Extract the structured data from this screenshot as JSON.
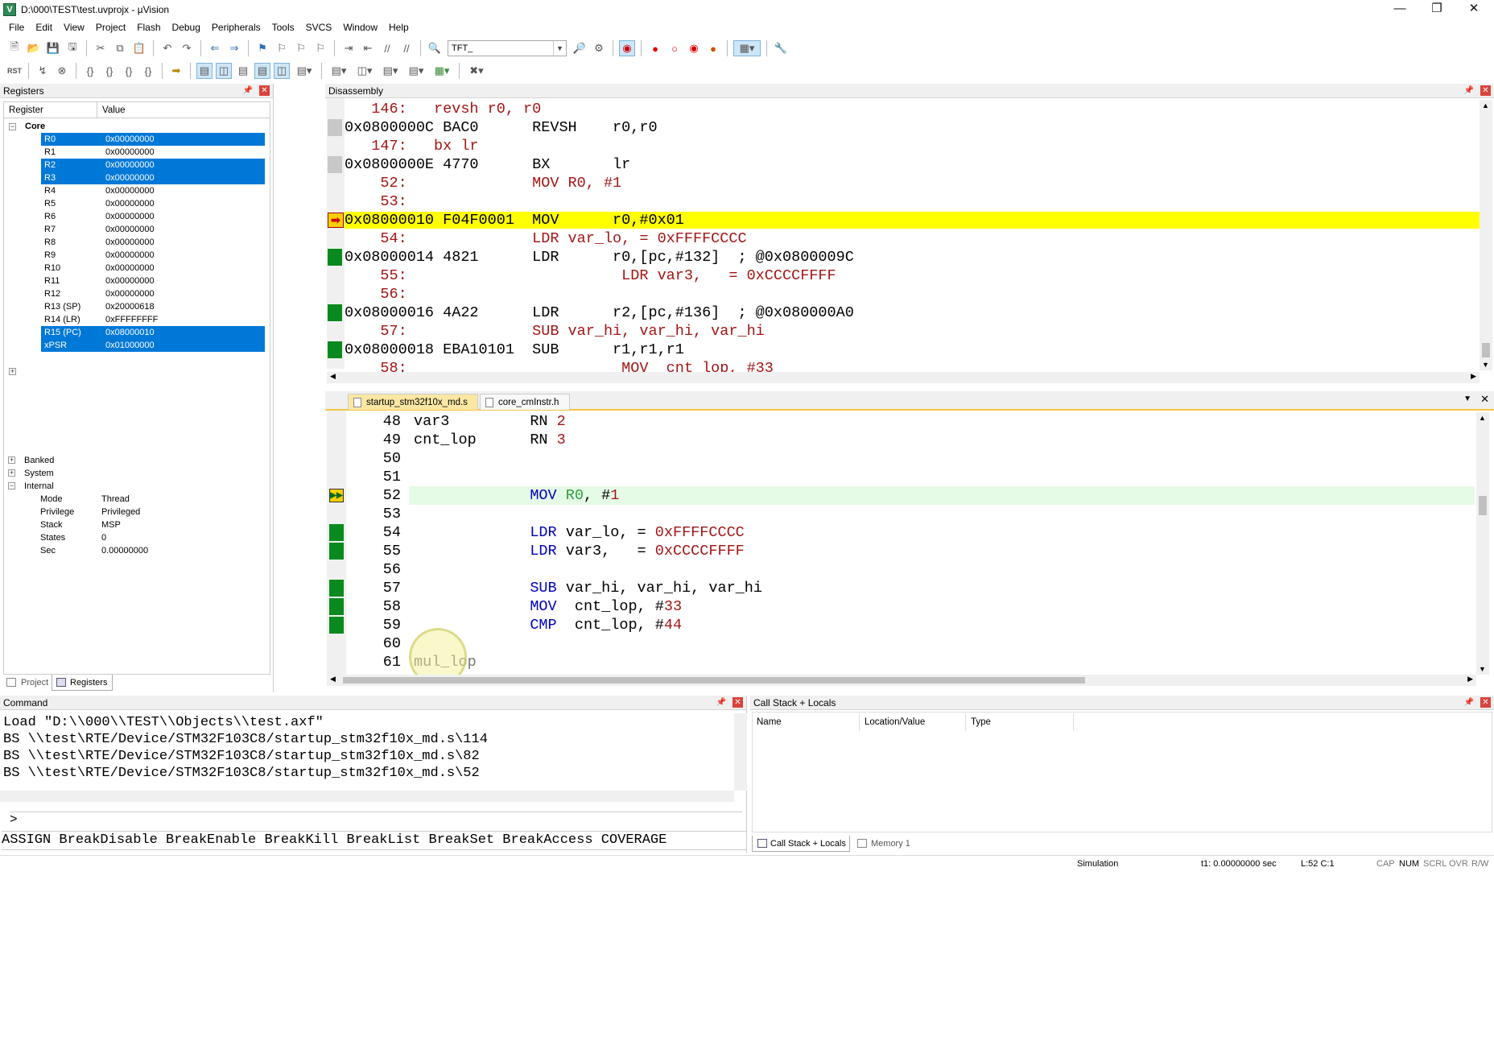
{
  "window": {
    "title": "D:\\000\\TEST\\test.uvprojx - µVision",
    "icon": "uvision-icon",
    "controls": [
      "minimize",
      "restore",
      "close"
    ]
  },
  "menu": [
    "File",
    "Edit",
    "View",
    "Project",
    "Flash",
    "Debug",
    "Peripherals",
    "Tools",
    "SVCS",
    "Window",
    "Help"
  ],
  "toolbar": {
    "target_combo": "TFT_"
  },
  "registers": {
    "title": "Registers",
    "col_register": "Register",
    "col_value": "Value",
    "core_label": "Core",
    "rows": [
      {
        "name": "R0",
        "value": "0x00000000",
        "selected": true
      },
      {
        "name": "R1",
        "value": "0x00000000",
        "selected": false
      },
      {
        "name": "R2",
        "value": "0x00000000",
        "selected": true
      },
      {
        "name": "R3",
        "value": "0x00000000",
        "selected": true
      },
      {
        "name": "R4",
        "value": "0x00000000",
        "selected": false
      },
      {
        "name": "R5",
        "value": "0x00000000",
        "selected": false
      },
      {
        "name": "R6",
        "value": "0x00000000",
        "selected": false
      },
      {
        "name": "R7",
        "value": "0x00000000",
        "selected": false
      },
      {
        "name": "R8",
        "value": "0x00000000",
        "selected": false
      },
      {
        "name": "R9",
        "value": "0x00000000",
        "selected": false
      },
      {
        "name": "R10",
        "value": "0x00000000",
        "selected": false
      },
      {
        "name": "R11",
        "value": "0x00000000",
        "selected": false
      },
      {
        "name": "R12",
        "value": "0x00000000",
        "selected": false
      },
      {
        "name": "R13 (SP)",
        "value": "0x20000618",
        "selected": false
      },
      {
        "name": "R14 (LR)",
        "value": "0xFFFFFFFF",
        "selected": false
      },
      {
        "name": "R15 (PC)",
        "value": "0x08000010",
        "selected": true
      },
      {
        "name": "xPSR",
        "value": "0x01000000",
        "selected": true
      }
    ],
    "groups": {
      "banked": "Banked",
      "system": "System",
      "internal": "Internal"
    },
    "internal": [
      {
        "name": "Mode",
        "value": "Thread"
      },
      {
        "name": "Privilege",
        "value": "Privileged"
      },
      {
        "name": "Stack",
        "value": "MSP"
      },
      {
        "name": "States",
        "value": "0"
      },
      {
        "name": "Sec",
        "value": "0.00000000"
      }
    ],
    "tabs": {
      "project": "Project",
      "registers": "Registers"
    }
  },
  "disassembly": {
    "title": "Disassembly",
    "lines": [
      {
        "text": "   146:   revsh r0, r0",
        "kind": "src"
      },
      {
        "text": "0x0800000C BAC0      REVSH    r0,r0",
        "kind": "asm",
        "mark": "gray"
      },
      {
        "text": "   147:   bx lr",
        "kind": "src"
      },
      {
        "text": "0x0800000E 4770      BX       lr",
        "kind": "asm",
        "mark": "gray"
      },
      {
        "text": "    52:              MOV R0, #1",
        "kind": "src"
      },
      {
        "text": "    53:",
        "kind": "src"
      },
      {
        "text": "0x08000010 F04F0001  MOV      r0,#0x01",
        "kind": "asm",
        "mark": "current"
      },
      {
        "text": "    54:              LDR var_lo, = 0xFFFFCCCC",
        "kind": "src"
      },
      {
        "text": "0x08000014 4821      LDR      r0,[pc,#132]  ; @0x0800009C",
        "kind": "asm",
        "mark": "green"
      },
      {
        "text": "    55:                        LDR var3,   = 0xCCCCFFFF",
        "kind": "src"
      },
      {
        "text": "    56:",
        "kind": "src"
      },
      {
        "text": "0x08000016 4A22      LDR      r2,[pc,#136]  ; @0x080000A0",
        "kind": "asm",
        "mark": "green"
      },
      {
        "text": "    57:              SUB var_hi, var_hi, var_hi",
        "kind": "src"
      },
      {
        "text": "0x08000018 EBA10101  SUB      r1,r1,r1",
        "kind": "asm",
        "mark": "green"
      },
      {
        "text": "    58:                        MOV  cnt_lop, #33",
        "kind": "src"
      }
    ]
  },
  "editor": {
    "tabs": [
      {
        "label": "startup_stm32f10x_md.s",
        "active": true
      },
      {
        "label": "core_cmInstr.h",
        "active": false
      }
    ],
    "lines": [
      {
        "num": "48",
        "mark": "",
        "parts": [
          [
            "var3         RN ",
            ""
          ],
          [
            "2",
            "red"
          ]
        ]
      },
      {
        "num": "49",
        "mark": "",
        "parts": [
          [
            "cnt_lop      RN ",
            ""
          ],
          [
            "3",
            "red"
          ]
        ]
      },
      {
        "num": "50",
        "mark": "",
        "parts": []
      },
      {
        "num": "51",
        "mark": "",
        "parts": []
      },
      {
        "num": "52",
        "mark": "current",
        "parts": [
          [
            "             ",
            ""
          ],
          [
            "MOV",
            "blue"
          ],
          [
            " ",
            ""
          ],
          [
            "R0",
            "grn"
          ],
          [
            ", #",
            ""
          ],
          [
            "1",
            "red"
          ]
        ]
      },
      {
        "num": "53",
        "mark": "",
        "parts": []
      },
      {
        "num": "54",
        "mark": "green",
        "parts": [
          [
            "             ",
            ""
          ],
          [
            "LDR",
            "blue"
          ],
          [
            " var_lo, = ",
            ""
          ],
          [
            "0xFFFFCCCC",
            "red"
          ]
        ]
      },
      {
        "num": "55",
        "mark": "green",
        "parts": [
          [
            "             ",
            ""
          ],
          [
            "LDR",
            "blue"
          ],
          [
            " var3,   = ",
            ""
          ],
          [
            "0xCCCCFFFF",
            "red"
          ]
        ]
      },
      {
        "num": "56",
        "mark": "",
        "parts": []
      },
      {
        "num": "57",
        "mark": "green",
        "parts": [
          [
            "             ",
            ""
          ],
          [
            "SUB",
            "blue"
          ],
          [
            " var_hi, var_hi, var_hi",
            ""
          ]
        ]
      },
      {
        "num": "58",
        "mark": "green",
        "parts": [
          [
            "             ",
            ""
          ],
          [
            "MOV",
            "blue"
          ],
          [
            "  cnt_lop, #",
            ""
          ],
          [
            "33",
            "red"
          ]
        ]
      },
      {
        "num": "59",
        "mark": "green",
        "parts": [
          [
            "             ",
            ""
          ],
          [
            "CMP",
            "blue"
          ],
          [
            "  cnt_lop, #",
            ""
          ],
          [
            "44",
            "red"
          ]
        ]
      },
      {
        "num": "60",
        "mark": "",
        "parts": []
      },
      {
        "num": "61",
        "mark": "",
        "parts": [
          [
            "mul_lop",
            ""
          ]
        ]
      }
    ]
  },
  "command": {
    "title": "Command",
    "output": [
      "Load \"D:\\\\000\\\\TEST\\\\Objects\\\\test.axf\"",
      "BS \\\\test\\RTE/Device/STM32F103C8/startup_stm32f10x_md.s\\114",
      "BS \\\\test\\RTE/Device/STM32F103C8/startup_stm32f10x_md.s\\82",
      "BS \\\\test\\RTE/Device/STM32F103C8/startup_stm32f10x_md.s\\52"
    ],
    "prompt": ">",
    "hints": "ASSIGN BreakDisable BreakEnable BreakKill BreakList BreakSet BreakAccess COVERAGE"
  },
  "callstack": {
    "title": "Call Stack + Locals",
    "columns": [
      "Name",
      "Location/Value",
      "Type"
    ],
    "tabs": {
      "callstack": "Call Stack + Locals",
      "memory": "Memory 1"
    }
  },
  "statusbar": {
    "mode": "Simulation",
    "time": "t1: 0.00000000 sec",
    "position": "L:52 C:1",
    "flags": [
      "CAP",
      "NUM",
      "SCRL",
      "OVR",
      "R/W"
    ]
  },
  "colors": {
    "selection": "#0078d7",
    "current_line": "#ffff00",
    "coverage": "#0a8a1e",
    "editor_current": "#e6fbe6"
  }
}
